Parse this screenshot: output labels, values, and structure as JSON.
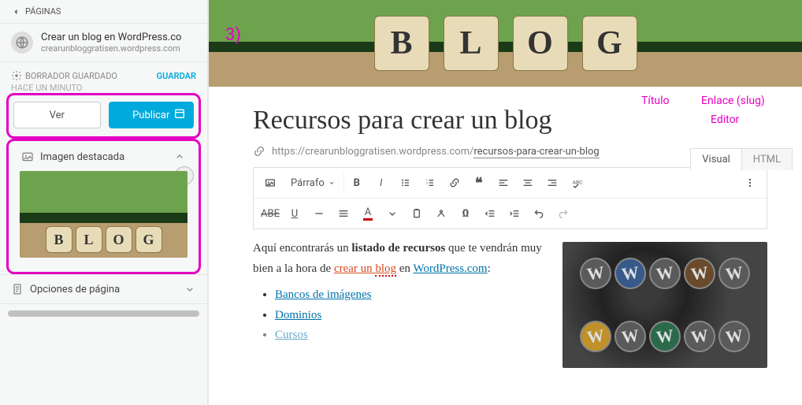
{
  "sidebar": {
    "back": "PÁGINAS",
    "page_title": "Crear un blog en WordPress.co",
    "page_sub": "crearunbloggratisen.wordpress.com",
    "status": "BORRADOR GUARDADO",
    "save": "GUARDAR",
    "status_sub": "HACE UN MINUTO",
    "view": "Ver",
    "publish": "Publicar",
    "featured_label": "Imagen destacada",
    "page_options": "Opciones de página"
  },
  "main": {
    "title": "Recursos para crear un blog",
    "slug_base": "https://crearunbloggratisen.wordpress.com/",
    "slug": "recursos-para-crear-un-blog",
    "tabs": {
      "visual": "Visual",
      "html": "HTML"
    },
    "paragraph": "Párrafo",
    "body": {
      "p1a": "Aquí encontrarás un ",
      "p1b": "listado de recursos",
      "p1c": " que te vendrán muy bien a la hora de ",
      "p1d": "crear un ",
      "p1e": "blog",
      "p1f": " en ",
      "p1g": "WordPress.com",
      "items": [
        "Bancos de imágenes",
        "Dominios",
        "Cursos"
      ]
    }
  },
  "annotations": {
    "n3": "3)",
    "titulo": "Título",
    "enlace": "Enlace (slug)",
    "editor": "Editor"
  }
}
